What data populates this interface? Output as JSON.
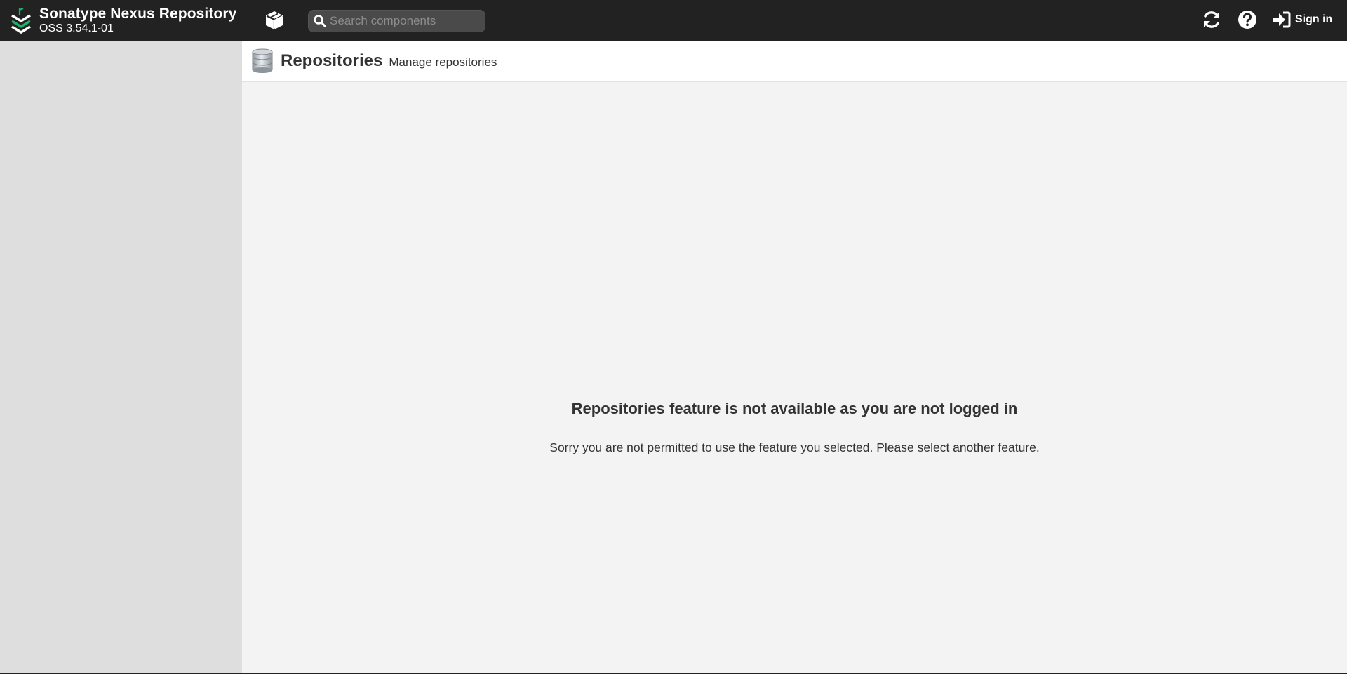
{
  "header": {
    "brand_name": "Sonatype Nexus Repository",
    "version": "OSS 3.54.1-01",
    "search": {
      "placeholder": "Search components"
    },
    "signin_label": "Sign in",
    "icons": {
      "logo": "nexus-logo-icon",
      "browse": "cube-icon",
      "search": "search-icon",
      "refresh": "refresh-icon",
      "help": "question-circle-icon",
      "signin": "sign-in-icon"
    }
  },
  "page": {
    "title": "Repositories",
    "subtitle": "Manage repositories",
    "icon": "database-icon"
  },
  "message": {
    "title": "Repositories feature is not available as you are not logged in",
    "body": "Sorry you are not permitted to use the feature you selected. Please select another feature."
  },
  "colors": {
    "header_bg": "#222222",
    "sidebar_bg": "#dedede",
    "content_bg": "#f3f3f3",
    "logo_green": "#1bb169"
  }
}
